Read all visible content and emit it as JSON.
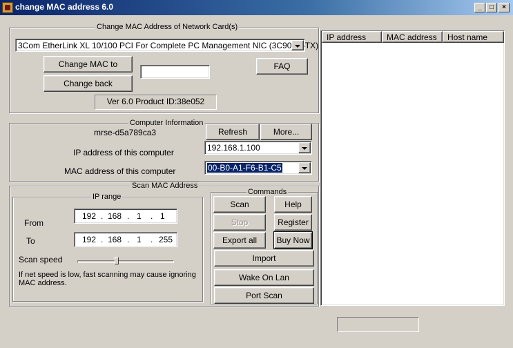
{
  "window": {
    "title": "change MAC address 6.0",
    "controls": {
      "minimize": "_",
      "maximize": "□",
      "close": "×"
    }
  },
  "mac_group": {
    "label": "Change MAC  Address of Network Card(s)",
    "nic_selected": "3Com EtherLink XL 10/100 PCI For Complete PC Management NIC (3C905C-TX)",
    "change_mac_button": "Change MAC to",
    "new_mac_value": "",
    "change_back_button": "Change back",
    "faq_button": "FAQ",
    "version": "Ver 6.0  Product ID:38e052"
  },
  "computer_group": {
    "label": "Computer Information",
    "computer_name": "mrse-d5a789ca3",
    "refresh_button": "Refresh",
    "more_button": "More...",
    "ip_label": "IP address of this computer",
    "ip_value": "192.168.1.100",
    "mac_label": "MAC address of this computer",
    "mac_value": "00-B0-A1-F6-B1-C5"
  },
  "scan_group": {
    "label": "Scan MAC Address",
    "ip_range_label": "IP range",
    "from_label": "From",
    "from_ip": [
      "192",
      "168",
      "1",
      "1"
    ],
    "to_label": "To",
    "to_ip": [
      "192",
      "168",
      "1",
      "255"
    ],
    "ip_dot": ".",
    "scan_speed_label": "Scan speed",
    "scan_speed_level": 0.4,
    "note": "If net speed is low,  fast scanning may cause ignoring MAC address."
  },
  "commands": {
    "label": "Commands",
    "scan": "Scan",
    "help": "Help",
    "stop": "Stop",
    "register": "Register",
    "export_all": "Export all",
    "buy_now": "Buy Now",
    "import": "Import",
    "wake_on_lan": "Wake On Lan",
    "port_scan": "Port Scan"
  },
  "results_list": {
    "columns": [
      "IP address",
      "MAC address",
      "Host name"
    ],
    "rows": []
  },
  "status_box": ""
}
